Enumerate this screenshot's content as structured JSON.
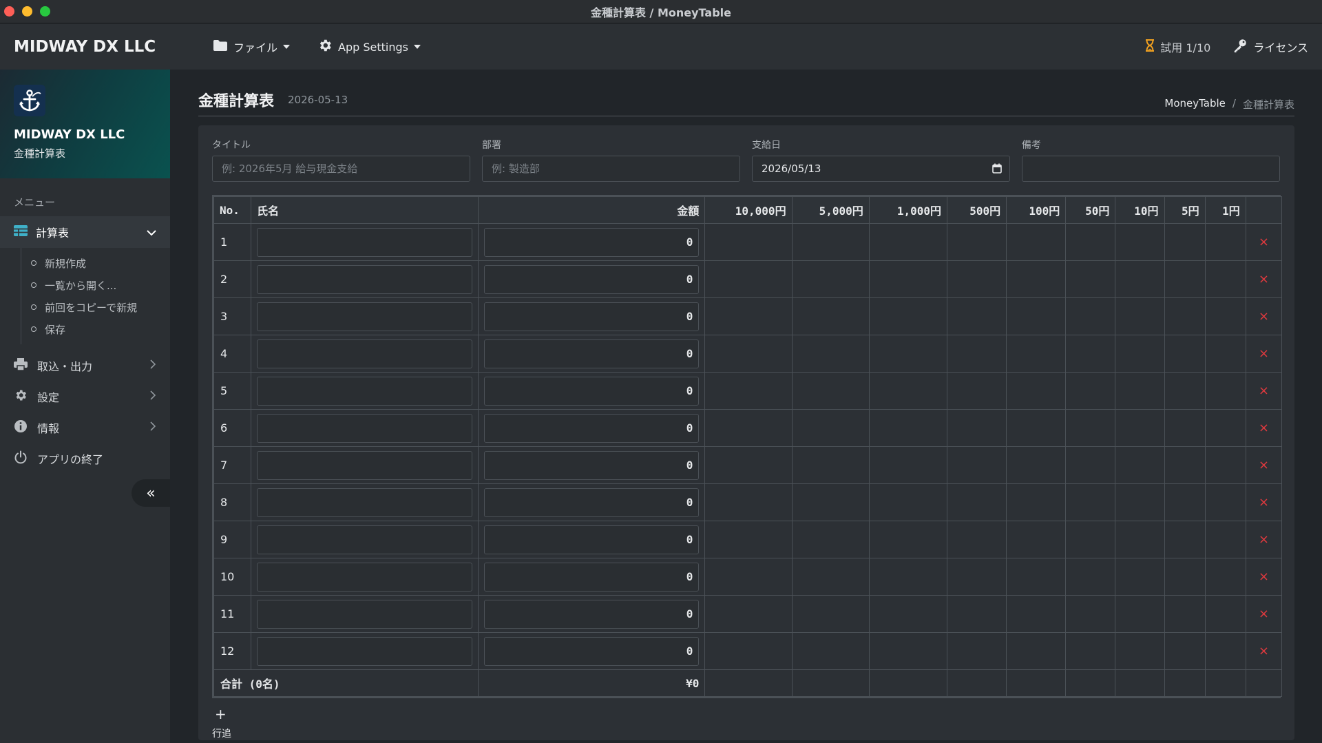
{
  "window": {
    "title": "金種計算表 / MoneyTable"
  },
  "navbar": {
    "brand": "MIDWAY DX LLC",
    "menu": [
      {
        "label": "ファイル",
        "icon": "folder-icon"
      },
      {
        "label": "App Settings",
        "icon": "gear-icon"
      }
    ],
    "trial": "試用 1/10",
    "license": "ライセンス"
  },
  "sidebar": {
    "company": "MIDWAY DX LLC",
    "subtitle": "金種計算表",
    "menu_label": "メニュー",
    "active_item": "計算表",
    "subitems": [
      "新規作成",
      "一覧から開く...",
      "前回をコピーで新規",
      "保存"
    ],
    "items": [
      {
        "label": "取込・出力",
        "icon": "printer-icon"
      },
      {
        "label": "設定",
        "icon": "gear-icon"
      },
      {
        "label": "情報",
        "icon": "info-icon"
      },
      {
        "label": "アプリの終了",
        "icon": "power-icon"
      }
    ],
    "collapse": "«"
  },
  "page": {
    "title": "金種計算表",
    "date": "2026-05-13",
    "breadcrumb": {
      "home": "MoneyTable",
      "separator": "/",
      "current": "金種計算表"
    }
  },
  "form": {
    "title_label": "タイトル",
    "title_placeholder": "例: 2026年5月 給与現金支給",
    "dept_label": "部署",
    "dept_placeholder": "例: 製造部",
    "date_label": "支給日",
    "date_value": "2026/05/13",
    "note_label": "備考",
    "note_value": ""
  },
  "table": {
    "headers": {
      "no": "No.",
      "name": "氏名",
      "amount": "金額",
      "denominations": [
        "10,000円",
        "5,000円",
        "1,000円",
        "500円",
        "100円",
        "50円",
        "10円",
        "5円",
        "1円"
      ]
    },
    "rows": [
      {
        "no": "1",
        "name": "",
        "amount": "0"
      },
      {
        "no": "2",
        "name": "",
        "amount": "0"
      },
      {
        "no": "3",
        "name": "",
        "amount": "0"
      },
      {
        "no": "4",
        "name": "",
        "amount": "0"
      },
      {
        "no": "5",
        "name": "",
        "amount": "0"
      },
      {
        "no": "6",
        "name": "",
        "amount": "0"
      },
      {
        "no": "7",
        "name": "",
        "amount": "0"
      },
      {
        "no": "8",
        "name": "",
        "amount": "0"
      },
      {
        "no": "9",
        "name": "",
        "amount": "0"
      },
      {
        "no": "10",
        "name": "",
        "amount": "0"
      },
      {
        "no": "11",
        "name": "",
        "amount": "0"
      },
      {
        "no": "12",
        "name": "",
        "amount": "0"
      }
    ],
    "delete_symbol": "×",
    "total_label": "合計 (0名)",
    "total_value": "¥0"
  },
  "add_row": {
    "symbol": "+",
    "label": "行追"
  },
  "colors": {
    "accent_delete": "#e0393e",
    "trial_icon": "#f0a020",
    "table_icon": "#3fb0c8"
  }
}
